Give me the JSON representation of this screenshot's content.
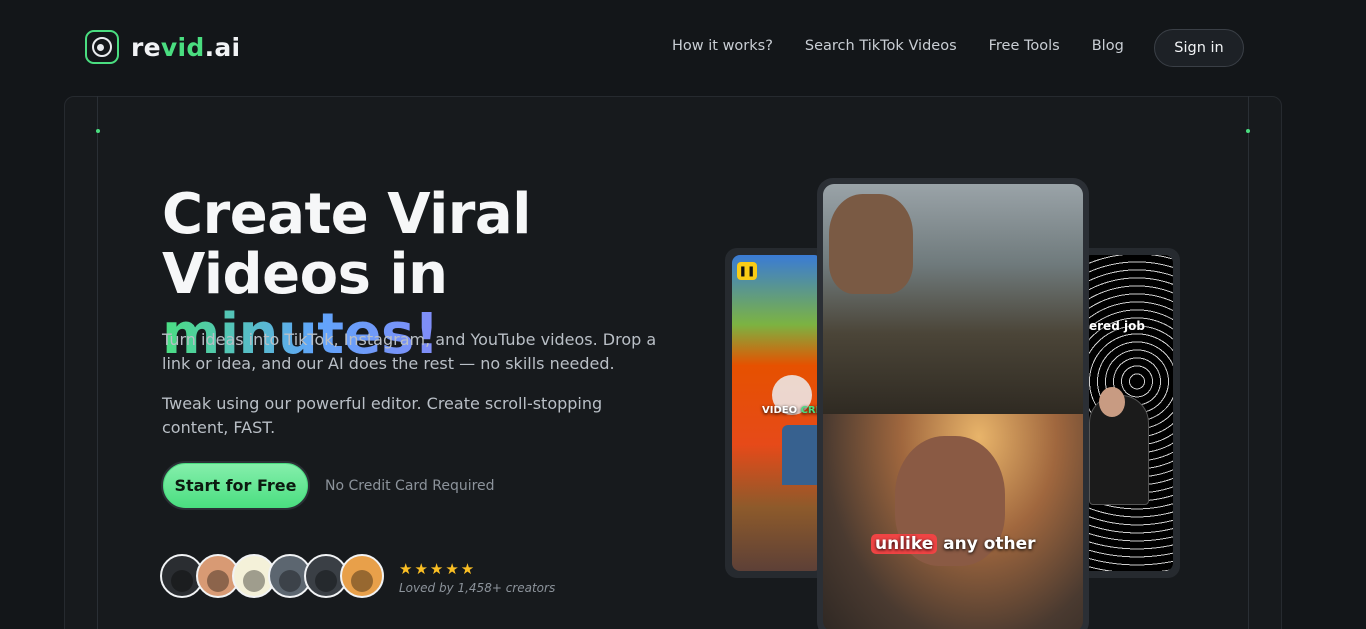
{
  "brand": {
    "name_main": "re",
    "name_accent": "vid",
    "name_suffix": ".ai"
  },
  "nav": {
    "links": [
      "How it works?",
      "Search TikTok Videos",
      "Free Tools",
      "Blog"
    ],
    "signin_label": "Sign in"
  },
  "hero": {
    "headline_line1": "Create Viral",
    "headline_line2_start": "Videos in ",
    "headline_gradient": "minutes!",
    "paragraph1": "Turn ideas into TikTok, Instagram, and YouTube videos. Drop a link or idea, and our AI does the rest — no skills needed.",
    "paragraph2": "Tweak using our powerful editor. Create scroll-stopping content, FAST.",
    "cta_label": "Start for Free",
    "cta_note": "No Credit Card Required",
    "stars": "★★★★★",
    "loved_text": "Loved by 1,458+ creators"
  },
  "phones": {
    "left_caption_white": "VIDEO ",
    "left_caption_accent": "CRE",
    "right_caption": "ered job",
    "main_caption_highlight": "unlike",
    "main_caption_rest": " any other",
    "pause_icon": "❚❚"
  },
  "colors": {
    "accent": "#4ade80",
    "background": "#131619"
  }
}
